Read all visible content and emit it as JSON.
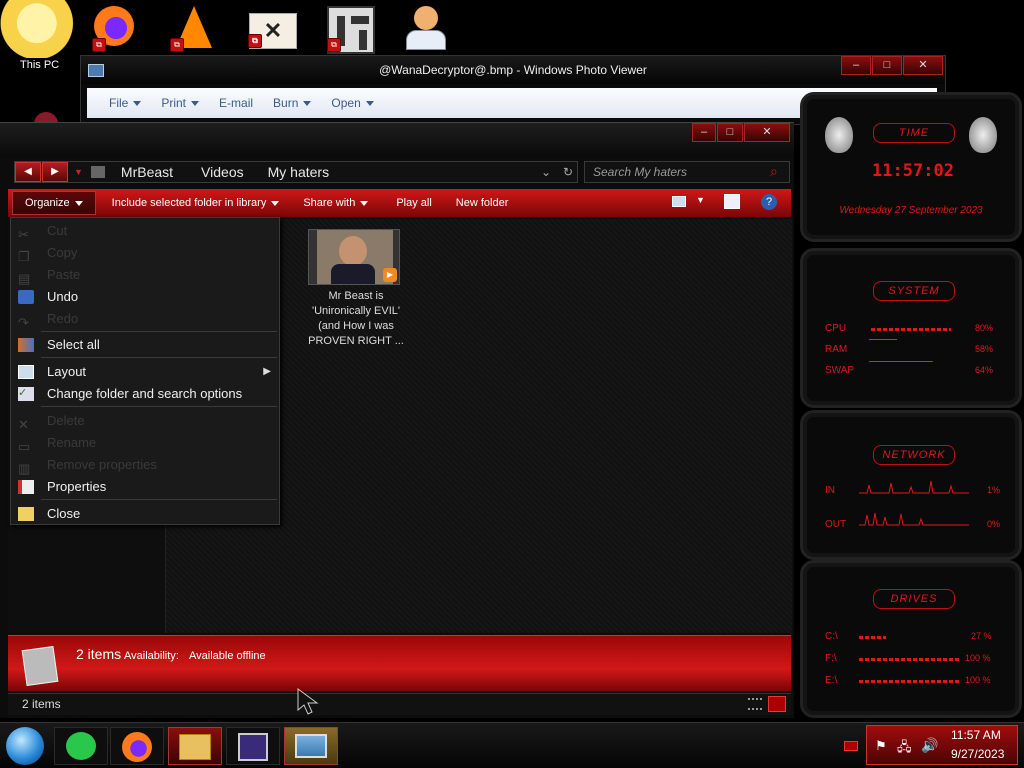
{
  "desktop": {
    "this_pc_label": "This PC",
    "icons": [
      "comic-character-icon",
      "firefox-icon",
      "vlc-icon",
      "hxd-icon",
      "maze-icon",
      "doctor-icon"
    ]
  },
  "photo_viewer": {
    "title": "@WanaDecryptor@.bmp - Windows Photo Viewer",
    "menu": [
      "File",
      "Print",
      "E-mail",
      "Burn",
      "Open"
    ],
    "buttons": {
      "minimize": "–",
      "maximize": "□",
      "close": "✕"
    }
  },
  "explorer": {
    "breadcrumb": [
      "MrBeast",
      "Videos",
      "My haters"
    ],
    "search_placeholder": "Search My haters",
    "commands": {
      "organize": "Organize",
      "include": "Include selected folder in library",
      "share": "Share with",
      "play_all": "Play all",
      "new_folder": "New folder"
    },
    "file": {
      "name_line1": "Mr Beast is",
      "name_line2": "'Unironically EVIL'",
      "name_line3": "(and How I was",
      "name_line4": "PROVEN RIGHT ..."
    },
    "details": {
      "count": "2 items",
      "availability_label": "Availability:",
      "availability_value": "Available offline"
    },
    "status": {
      "items": "2 items"
    }
  },
  "context_menu": {
    "items": [
      {
        "label": "Cut",
        "enabled": false
      },
      {
        "label": "Copy",
        "enabled": false
      },
      {
        "label": "Paste",
        "enabled": false
      },
      {
        "label": "Undo",
        "enabled": true
      },
      {
        "label": "Redo",
        "enabled": false
      },
      {
        "label": "Select all",
        "enabled": true
      },
      {
        "label": "Layout",
        "enabled": true
      },
      {
        "label": "Change folder and search options",
        "enabled": true
      },
      {
        "label": "Delete",
        "enabled": false
      },
      {
        "label": "Rename",
        "enabled": false
      },
      {
        "label": "Remove properties",
        "enabled": false
      },
      {
        "label": "Properties",
        "enabled": true
      },
      {
        "label": "Close",
        "enabled": true
      }
    ]
  },
  "gadgets": {
    "time": {
      "header": "TIME",
      "clock": "11:57:02",
      "date": "Wednesday 27 September 2023"
    },
    "system": {
      "header": "SYSTEM",
      "cpu_label": "CPU",
      "cpu_value": "80%",
      "ram_label": "RAM",
      "ram_value": "58%",
      "swap_label": "SWAP",
      "swap_value": "64%",
      "cpu_level": 0.8,
      "ram_level": 0.58,
      "swap_level": 0.64
    },
    "network": {
      "header": "NETWORK",
      "in_label": "IN",
      "in_value": "1%",
      "out_label": "OUT",
      "out_value": "0%"
    },
    "drives": {
      "header": "DRIVES",
      "drives": [
        {
          "label": "C:\\",
          "value": "27 %",
          "level": 0.27
        },
        {
          "label": "F:\\",
          "value": "100 %",
          "level": 1
        },
        {
          "label": "E:\\",
          "value": "100 %",
          "level": 1
        }
      ]
    }
  },
  "taskbar": {
    "time": "11:57 AM",
    "date": "9/27/2023",
    "apps": [
      "start-orb-icon",
      "notes-app-icon",
      "firefox-icon",
      "file-explorer-icon",
      "cpu-app-icon",
      "photo-viewer-icon"
    ]
  },
  "colors": {
    "accent_red": "#d01818",
    "dark_red": "#5a0808",
    "background": "#000000"
  }
}
